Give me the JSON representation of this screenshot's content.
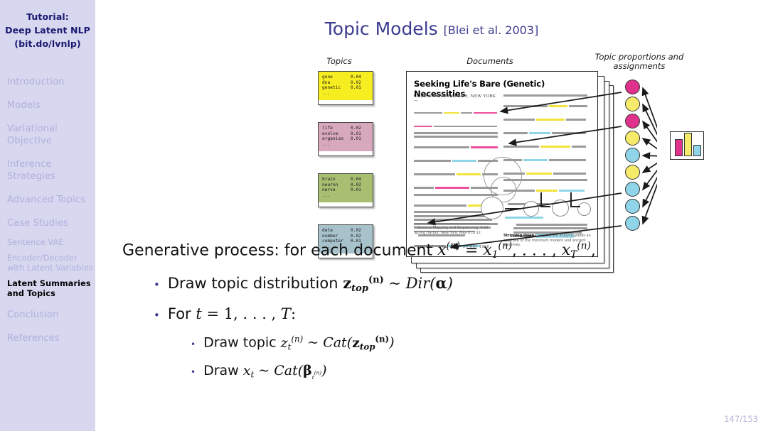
{
  "sidebar": {
    "title_lines": [
      "Tutorial:",
      "Deep Latent NLP",
      "(bit.do/lvnlp)"
    ],
    "items": [
      {
        "label": "Introduction",
        "level": 1,
        "active": false
      },
      {
        "label": "Models",
        "level": 1,
        "active": false
      },
      {
        "label": "Variational Objective",
        "level": 1,
        "active": false
      },
      {
        "label": "Inference Strategies",
        "level": 1,
        "active": false
      },
      {
        "label": "Advanced Topics",
        "level": 1,
        "active": false
      },
      {
        "label": "Case Studies",
        "level": 1,
        "active": false
      },
      {
        "label": "Sentence VAE",
        "level": 2,
        "active": false
      },
      {
        "label": "Encoder/Decoder with Latent Variables",
        "level": 2,
        "active": false
      },
      {
        "label": "Latent Summaries and Topics",
        "level": 2,
        "active": true
      },
      {
        "label": "Conclusion",
        "level": 1,
        "active": false
      },
      {
        "label": "References",
        "level": 1,
        "active": false
      }
    ],
    "colors": {
      "background": "#d7d7f0",
      "title": "#191970",
      "inactive": "#b0b0dc",
      "active": "#000000"
    }
  },
  "slide": {
    "title": "Topic Models",
    "citation": "[Blei et al. 2003]",
    "title_color": "#3b3b8f",
    "page_number": "147/153"
  },
  "figure": {
    "labels": {
      "topics": "Topics",
      "documents": "Documents",
      "proportions": "Topic proportions and assignments"
    },
    "topic_cards": [
      {
        "color": "#f7ee22",
        "rows": [
          [
            "gene",
            "0.04"
          ],
          [
            "dna",
            "0.02"
          ],
          [
            "genetic",
            "0.01"
          ]
        ],
        "ellipsis": "..."
      },
      {
        "color": "#d8a9bd",
        "rows": [
          [
            "life",
            "0.02"
          ],
          [
            "evolve",
            "0.01"
          ],
          [
            "organism",
            "0.01"
          ]
        ],
        "ellipsis": "..."
      },
      {
        "color": "#a8bf72",
        "rows": [
          [
            "brain",
            "0.04"
          ],
          [
            "neuron",
            "0.02"
          ],
          [
            "nerve",
            "0.01"
          ]
        ],
        "ellipsis": "..."
      },
      {
        "color": "#a8c2cc",
        "rows": [
          [
            "data",
            "0.02"
          ],
          [
            "number",
            "0.02"
          ],
          [
            "computer",
            "0.01"
          ]
        ],
        "ellipsis": "..."
      }
    ],
    "document": {
      "headline": "Seeking Life's Bare (Genetic) Necessities",
      "dateline": "COLD SPRING HARBOR, NEW YORK—",
      "footnote": "* Genome Mapping and Sequencing, Cold Spring Harbor, New York, May 8 to 12.",
      "source_line": "SCIENCE • VOL. 272 • 24 MAY 1996",
      "fig_caption_bold": "Stripping down",
      "fig_caption_highlight": "Comparative analysis",
      "fig_caption_rest": "yields an estimate of the minimum modern and ancient genomes."
    },
    "assignment_circles": [
      "magenta",
      "yellow",
      "magenta",
      "yellow",
      "cyan",
      "yellow",
      "cyan",
      "cyan",
      "cyan"
    ],
    "circle_colors": {
      "magenta": "#e0318c",
      "yellow": "#f5ea6a",
      "cyan": "#8fd4e8"
    },
    "proportion_bars": [
      {
        "color": "#e0318c",
        "height_pct": 62
      },
      {
        "color": "#f5ea6a",
        "height_pct": 88
      },
      {
        "color": "#8fd4e8",
        "height_pct": 40
      }
    ],
    "highlight_colors": {
      "yellow": "#f2e43a",
      "pink": "#ec4f9c",
      "cyan": "#8fd6e8"
    }
  },
  "body": {
    "line1_prefix": "Generative process: for each document",
    "line1_math_x": "x",
    "line1_eq": "=",
    "line1_tail": ",",
    "line2_text": "Draw topic distribution",
    "line2_z": "z",
    "line2_sub": "top",
    "line2_sim": "~",
    "line2_dist": "Dir(",
    "line2_alpha": "α",
    "line2_close": ")",
    "line3_text": "For",
    "line3_t": "t",
    "line3_eq": "= 1,",
    "line3_dots": ". . . ,",
    "line3_T": "T",
    "line3_colon": ":",
    "line4_text": "Draw topic",
    "line4_z": "z",
    "line4_sim": "~",
    "line4_cat": "Cat(",
    "line4_zbold": "z",
    "line4_sub": "top",
    "line4_close": ")",
    "line5_text": "Draw",
    "line5_x": "x",
    "line5_subt": "t",
    "line5_sim": "~",
    "line5_cat": "Cat(",
    "line5_beta": "β",
    "line5_close": ")",
    "sup_n": "(n)",
    "sub_1": "1",
    "sub_T": "T",
    "sub_t": "t",
    "dots": ". . . ,"
  }
}
